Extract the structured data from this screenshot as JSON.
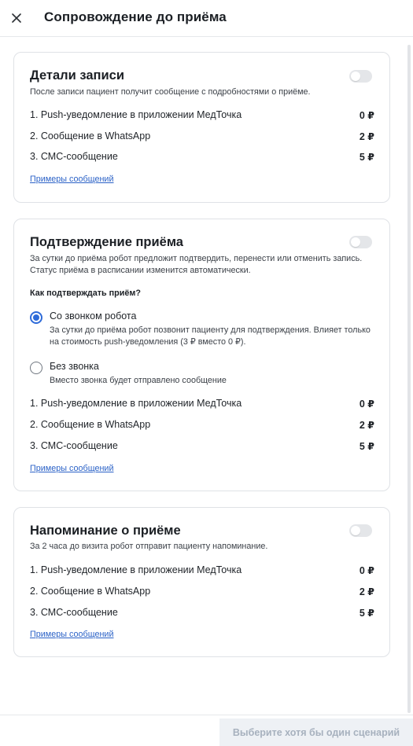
{
  "header": {
    "title": "Сопровождение до приёма"
  },
  "cards": [
    {
      "title": "Детали записи",
      "description": "После записи пациент получит сообщение с подробностями о приёме.",
      "items": [
        {
          "label": "1. Push-уведомление в приложении МедТочка",
          "price": "0 ₽"
        },
        {
          "label": "2. Сообщение в WhatsApp",
          "price": "2 ₽"
        },
        {
          "label": "3. СМС-сообщение",
          "price": "5 ₽"
        }
      ],
      "link": "Примеры сообщений"
    },
    {
      "title": "Подтверждение приёма",
      "description": "За сутки до приёма робот предложит подтвердить, перенести или отменить запись. Статус приёма в расписании изменится автоматически.",
      "question": "Как подтверждать приём?",
      "options": [
        {
          "label": "Со звонком робота",
          "description": "За сутки до приёма робот позвонит пациенту для подтверждения. Влияет только на стоимость push-уведомления (3 ₽ вместо 0 ₽).",
          "selected": true
        },
        {
          "label": "Без звонка",
          "description": "Вместо звонка будет отправлено сообщение",
          "selected": false
        }
      ],
      "items": [
        {
          "label": "1. Push-уведомление в приложении МедТочка",
          "price": "0 ₽"
        },
        {
          "label": "2. Сообщение в WhatsApp",
          "price": "2 ₽"
        },
        {
          "label": "3. СМС-сообщение",
          "price": "5 ₽"
        }
      ],
      "link": "Примеры сообщений"
    },
    {
      "title": "Напоминание о приёме",
      "description": "За 2 часа до визита робот отправит пациенту напоминание.",
      "items": [
        {
          "label": "1. Push-уведомление в приложении МедТочка",
          "price": "0 ₽"
        },
        {
          "label": "2. Сообщение в WhatsApp",
          "price": "2 ₽"
        },
        {
          "label": "3. СМС-сообщение",
          "price": "5 ₽"
        }
      ],
      "link": "Примеры сообщений"
    }
  ],
  "footer": {
    "submit_label": "Выберите хотя бы один сценарий",
    "submit_enabled": false
  },
  "colors": {
    "accent": "#2e6bd9",
    "link": "#2b62c7",
    "toggle_off": "#e4e6e9",
    "disabled_button_bg": "#eef1f5",
    "disabled_button_text": "#a7b1be"
  }
}
